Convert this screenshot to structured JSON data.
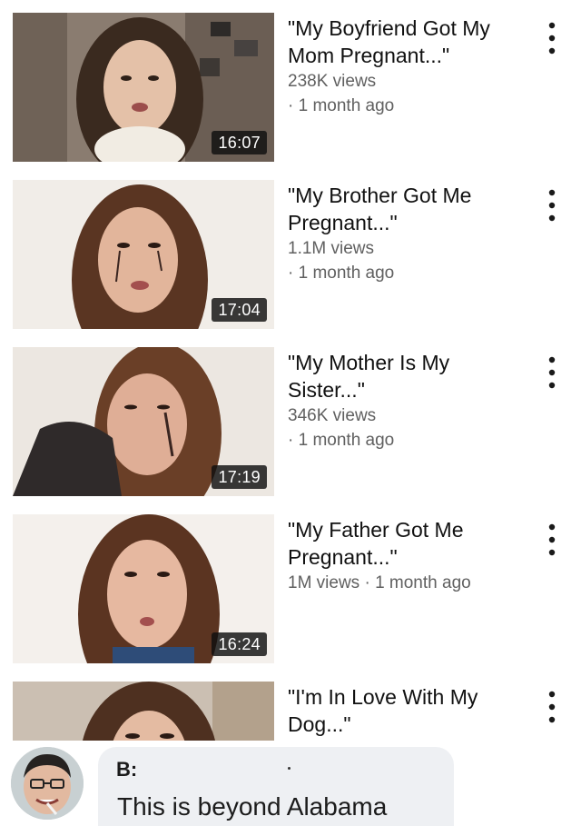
{
  "videos": [
    {
      "title": "\"My Boyfriend Got My Mom Pregnant...\"",
      "title_lines": [
        "\"My Boyfriend Got My",
        "Mom Pregnant...\""
      ],
      "sub_lines": [
        "238K views",
        "· 1 month ago"
      ],
      "duration": "16:07"
    },
    {
      "title": "\"My Brother Got Me Pregnant...\"",
      "title_lines": [
        "\"My Brother Got Me",
        "Pregnant...\""
      ],
      "sub_lines": [
        "1.1M views",
        "· 1 month ago"
      ],
      "duration": "17:04"
    },
    {
      "title": "\"My Mother Is My Sister...\"",
      "title_lines": [
        "\"My Mother Is My",
        "Sister...\""
      ],
      "sub_lines": [
        "346K views",
        "· 1 month ago"
      ],
      "duration": "17:19"
    },
    {
      "title": "\"My Father Got Me Pregnant...\"",
      "title_lines": [
        "\"My Father Got Me",
        "Pregnant...\""
      ],
      "sub_lines": [
        "1M views · 1 month ago"
      ],
      "duration": "16:24"
    },
    {
      "title": "\"I'm In Love With My Dog...\"",
      "title_lines": [
        "\"I'm In Love With My",
        "Dog...\""
      ],
      "sub_lines": [],
      "duration": ""
    }
  ],
  "comment": {
    "author": "B:",
    "text": "This is beyond Alabama"
  },
  "colors": {
    "title": "#111111",
    "meta": "#606060",
    "duration_bg": "#0f0f0f",
    "bubble": "#eef0f3"
  },
  "icons": {
    "more": "more-vert-icon"
  }
}
